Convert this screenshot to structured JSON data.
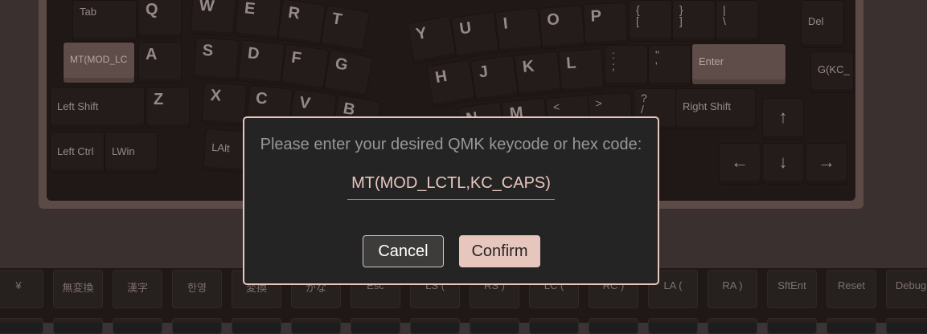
{
  "keyboard": {
    "keys": {
      "tab": "Tab",
      "q": "Q",
      "w": "W",
      "e": "E",
      "r": "R",
      "t": "T",
      "y": "Y",
      "u": "U",
      "i": "I",
      "o": "O",
      "p": "P",
      "lbracket_top": "{",
      "lbracket_bot": "[",
      "rbracket_top": "}",
      "rbracket_bot": "]",
      "pipe_top": "|",
      "pipe_bot": "\\",
      "del": "Del",
      "mt_mod": "MT(MOD_LC",
      "a": "A",
      "s": "S",
      "d": "D",
      "f": "F",
      "g": "G",
      "h": "H",
      "j": "J",
      "k": "K",
      "l": "L",
      "semicolon_top": ":",
      "semicolon_bot": ";",
      "quote_top": "\"",
      "quote_bot": "'",
      "enter": "Enter",
      "g_kc": "G(KC_",
      "left_shift": "Left Shift",
      "z": "Z",
      "x": "X",
      "c": "C",
      "v": "V",
      "b": "B",
      "n": "N",
      "m": "M",
      "comma": "<",
      "period": ">",
      "slash_top": "?",
      "slash_bot": "/",
      "right_shift": "Right Shift",
      "left_ctrl": "Left Ctrl",
      "lwin": "LWin",
      "lalt": "LAlt",
      "arrow_up": "↑",
      "arrow_left": "←",
      "arrow_down": "↓",
      "arrow_right": "→"
    }
  },
  "palette": {
    "keys": [
      "¥",
      "無変換",
      "漢字",
      "한영",
      "変換",
      "かな",
      "Esc",
      "LS (",
      "RS )",
      "LC (",
      "RC )",
      "LA (",
      "RA )",
      "SftEnt",
      "Reset",
      "Debug"
    ]
  },
  "dialog": {
    "title": "Please enter your desired QMK keycode or hex code:",
    "input_value": "MT(MOD_LCTL,KC_CAPS)",
    "cancel_label": "Cancel",
    "confirm_label": "Confirm"
  },
  "colors": {
    "accent": "#e7c7bd",
    "dialog_bg": "#252424",
    "page_bg": "#3a3434"
  }
}
